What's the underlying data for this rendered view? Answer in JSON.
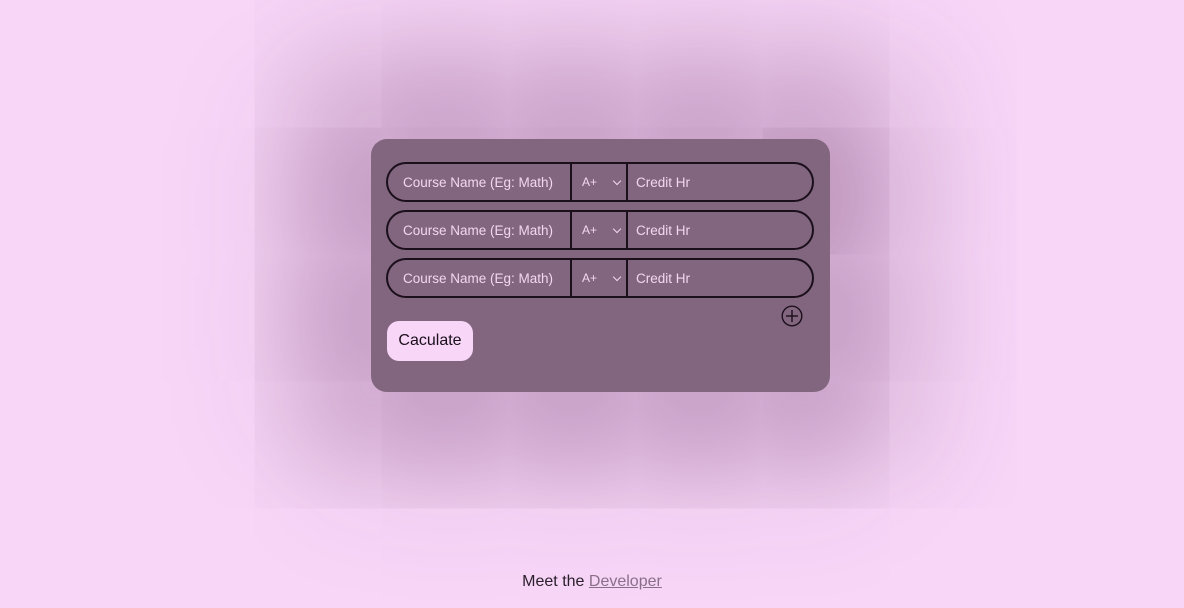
{
  "form": {
    "rows": [
      {
        "course_placeholder": "Course Name (Eg: Math)",
        "grade": "A+",
        "credit_placeholder": "Credit Hr"
      },
      {
        "course_placeholder": "Course Name (Eg: Math)",
        "grade": "A+",
        "credit_placeholder": "Credit Hr"
      },
      {
        "course_placeholder": "Course Name (Eg: Math)",
        "grade": "A+",
        "credit_placeholder": "Credit Hr"
      }
    ],
    "calculate_label": "Caculate",
    "add_icon": "plus-circle-icon"
  },
  "footer": {
    "prefix": "Meet the",
    "link_label": "Developer"
  },
  "colors": {
    "background": "#f7d6f8",
    "card": "#82667f",
    "border": "#1a0f1a",
    "placeholder_text": "#f3d6f2",
    "link": "#8a6f88"
  }
}
